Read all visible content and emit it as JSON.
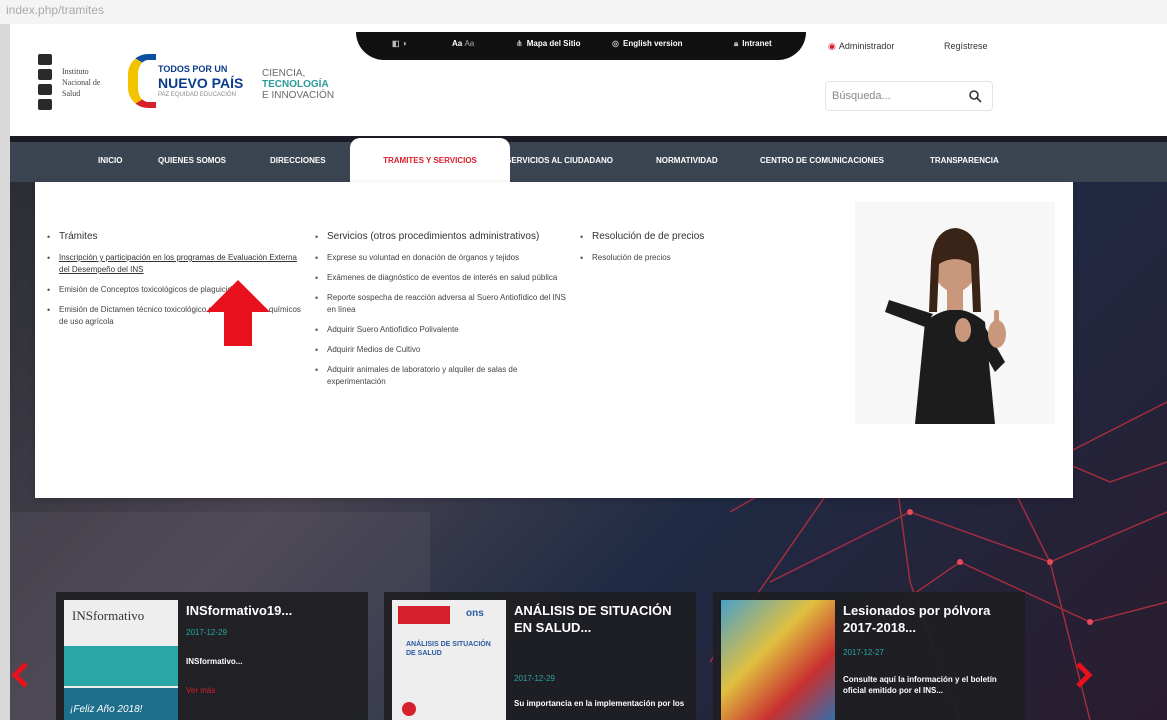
{
  "browser": {
    "url_fragment": "index.php/tramites"
  },
  "header": {
    "logo_ins": {
      "lines": [
        "Instituto",
        "Nacional de",
        "Salud"
      ]
    },
    "logo_tpun": {
      "line1": "TODOS POR UN",
      "line2": "NUEVO PAÍS",
      "line3": "PAZ EQUIDAD EDUCACIÓN"
    },
    "logo_cti": {
      "line1": "CIENCIA,",
      "line2": "TECNOLOGÍA",
      "line3": "E INNOVACIÓN"
    },
    "utility": {
      "contrast_label": "",
      "size_big": "Aa",
      "size_small": "Aa",
      "site_map": "Mapa del Sitio",
      "english": "English version",
      "intranet": "Intranet"
    },
    "login": {
      "admin": "Administrador",
      "register": "Regístrese"
    },
    "search": {
      "placeholder": "Búsqueda..."
    }
  },
  "nav": {
    "items": [
      "INICIO",
      "QUIENES SOMOS",
      "DIRECCIONES",
      "TRAMITES Y SERVICIOS",
      "SERVICIOS AL CIUDADANO",
      "NORMATIVIDAD",
      "CENTRO DE COMUNICACIONES",
      "TRANSPARENCIA"
    ],
    "active": "TRAMITES Y SERVICIOS"
  },
  "mega_menu": {
    "col1": {
      "heading": "Trámites",
      "items": [
        "Inscripción y participación en los programas de Evaluación Externa del Desempeño del INS",
        "Emisión de Conceptos toxicológicos de plaguicidas",
        "Emisión de Dictamen técnico toxicológico para plaguicidas químicos de uso agrícola"
      ]
    },
    "col2": {
      "heading": "Servicios (otros procedimientos administrativos)",
      "items": [
        "Exprese su voluntad en donación de órganos y tejidos",
        "Exámenes de diagnóstico de eventos de interés en salud pública",
        "Reporte sospecha de reacción adversa al Suero Antiofídico del INS en línea",
        "Adquirir Suero Antiofídico Polivalente",
        "Adquirir Medios de Cultivo",
        "Adquirir animales de laboratorio y alquiler de salas de experimentación"
      ]
    },
    "col3": {
      "heading": "Resolución de de precios",
      "items": [
        "Resolución de precios"
      ]
    }
  },
  "cards": [
    {
      "title": "INSformativo19...",
      "date": "2017-12-29",
      "desc": "INSformativo...",
      "more": "Ver más",
      "thumb_text": "INSformativo",
      "thumb_footer": "¡Feliz Año 2018!"
    },
    {
      "title": "ANÁLISIS DE SITUACIÓN EN SALUD...",
      "date": "2017-12-29",
      "desc": "Su importancia en la implementación por los",
      "thumb_text": "ANÁLISIS DE SITUACIÓN DE SALUD",
      "thumb_brand": "ons"
    },
    {
      "title": "Lesionados por pólvora 2017-2018...",
      "date": "2017-12-27",
      "desc": "Consulte aquí la información y el boletín oficial emitido por el INS..."
    }
  ],
  "colors": {
    "nav_bg": "#3b4552",
    "accent_red": "#d6202c",
    "teal": "#2aa6a6"
  }
}
